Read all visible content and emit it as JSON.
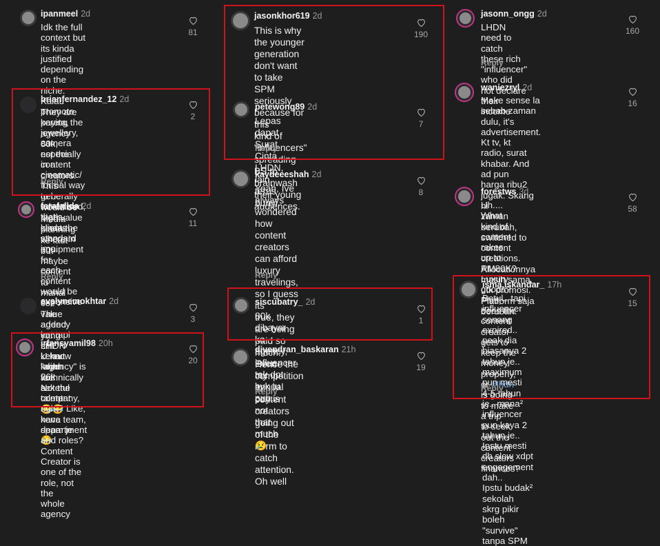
{
  "highlight_color": "#d0121b",
  "like_icon": "heart-outline-icon",
  "reply_label": "Reply",
  "comments": [
    {
      "user": "ipanmeel",
      "time": "2d",
      "text": "Idk the full context but its kinda\njustified depending on the niche.\nKalau promote kereta, jewellery,\ncamera especially in a cinematic/\nformal way to be advertised,\nthat's kinda the standard imo.",
      "likes": "81"
    },
    {
      "user": "brianfernandez_12",
      "time": "2d",
      "text": "They are paying the agency 80k,\nnot the content creators. This\ngenerally would be high value\nclients where in equipment for\neach content would be\nexpensive",
      "likes": "2"
    },
    {
      "user": "farafalida",
      "time": "2d",
      "text": "Media planning ke laut but\nmaybe content tu mahal coz\nvalue added kot tapi still kelaut\nlahhh 26k seketul content mcm\nkena spam je😂",
      "likes": "11"
    },
    {
      "user": "evelynemokhtar",
      "time": "2d",
      "text": "The agency yang LHDN kena\nkejar kot. Not the talent 😂😂",
      "likes": "3"
    },
    {
      "user": "irfansyamil98",
      "time": "20h",
      "text": "U know \"agency\" is technically a\ncompany, right? Like, have team,\ndepartment and roles? Content\nCreator is one of the role, not the\nwhole agency",
      "likes": "20"
    },
    {
      "user": "jasonkhor619",
      "time": "2d",
      "text": "This is why the younger\ngeneration don't want to take\nSPM seriously because for this\nkind of \"influencers\" spreading\nBS to brainwash their young\naudiences.",
      "likes": "190"
    },
    {
      "user": "petewong89",
      "time": "2d",
      "text": "Lepas dapat Surat Cinta LHDN,\nlain terus bunyi.",
      "likes": "7"
    },
    {
      "user": "kaydeeeshah",
      "time": "2d",
      "text": "Yeah, Ive always wondered how\ncontent creators can afford\nluxury travelings, so I guess its\ntrue, they are being paid so\nmuch. Hence the competition in\ncontent creators going out of the\nnorm to catch attention. Oh well",
      "likes": "8"
    },
    {
      "user": "siscubatry_",
      "time": "2d",
      "text": "80k dibayar ke agency,\ninfluencer tak dpt byk tu pun..",
      "likes": "1"
    },
    {
      "user": "divendran_baskaran",
      "time": "21h",
      "text": "Even my annual pay is not that\nmuch 😢",
      "likes": "19"
    },
    {
      "user": "jasonn_ongg",
      "time": "2d",
      "text": "LHDN need to catch these rich\n\"influencer\" who did not declare\ntheir income",
      "likes": "160"
    },
    {
      "user": "waniezryl",
      "time": "2d",
      "text": "Make sense la sebab zaman\ndulu, it's advertisement. Kt tv, kt\nradio, surat khabar. And ad pun\nharga ribu2 jugak. Skang ni\nzaman berubah, switched to\ncontent creations. Allocationnya\nmasih sama, utk promosi.\nPlatform saja berubah.",
      "likes": "16"
    },
    {
      "user": "forestws",
      "time": "3d",
      "text_before_tag": "Uh.... What kind of content rakes\nup to RM80K? Luxury goods?\nPlus, does the content creator\ngets to keep the money properly,\nor ",
      "hashtag": "#lhdn",
      "text_after_tag": " is going to make a trip\nto seek out the content creators\nfinances?",
      "likes": "58"
    },
    {
      "user": "isma.iskandar_",
      "time": "17h",
      "text": "Betul.. tapi influencer senang\nexpired.. peak dia biasanya 2\ntahun je.. maximum pun mesti\n4-5 tahun je.. mana² influencer\npun kaya 2 tahun je.. Ipstu mesti\ndh slow xdpt engagement dah..\nIpstu budak² sekolah skrg pikir\nboleh \"survive\" tanpa SPM",
      "likes": "15"
    }
  ]
}
